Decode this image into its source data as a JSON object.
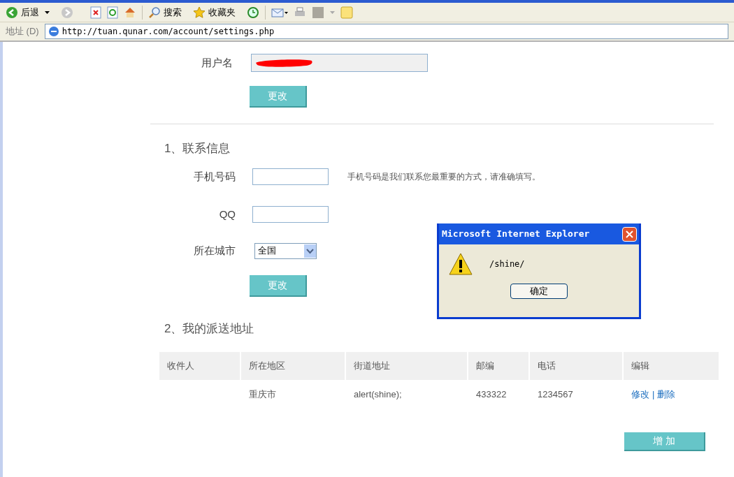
{
  "toolbar": {
    "back": "后退",
    "search": "搜索",
    "favorites": "收藏夹"
  },
  "address_bar": {
    "label": "地址 (D)",
    "url": "http://tuan.qunar.com/account/settings.php"
  },
  "username": {
    "label": "用户名",
    "button": "更改"
  },
  "contact": {
    "heading": "1、联系信息",
    "fields": [
      {
        "kind": "text",
        "label": "手机号码",
        "hint": "手机号码是我们联系您最重要的方式，请准确填写。"
      },
      {
        "kind": "text",
        "label": "QQ"
      },
      {
        "kind": "select",
        "label": "所在城市",
        "value": "全国"
      }
    ],
    "button": "更改"
  },
  "addresses": {
    "heading": "2、我的派送地址",
    "columns": [
      "收件人",
      "所在地区",
      "街道地址",
      "邮编",
      "电话",
      "编辑"
    ],
    "rows": [
      {
        "cells": [
          "",
          "重庆市",
          "alert(shine);",
          "433322",
          "1234567"
        ],
        "edit": "修改",
        "separator": "|",
        "delete": "删除"
      }
    ],
    "add_button": "增 加"
  },
  "dialog": {
    "title": "Microsoft Internet Explorer",
    "message": "/shine/",
    "button": "确定"
  }
}
